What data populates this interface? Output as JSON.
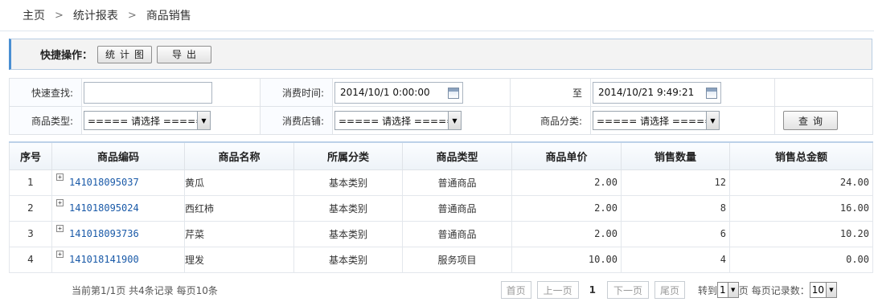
{
  "breadcrumb": {
    "items": [
      "主页",
      "统计报表",
      "商品销售"
    ],
    "separator": ">"
  },
  "quick_actions": {
    "label": "快捷操作：",
    "buttons": [
      "统计图",
      "导出"
    ]
  },
  "filters": {
    "quick_search_label": "快速查找:",
    "quick_search_value": "",
    "time_label": "消费时间:",
    "time_from": "2014/10/1 0:00:00",
    "to_label": "至",
    "time_to": "2014/10/21 9:49:21",
    "product_type_label": "商品类型:",
    "product_type_value": "===== 请选择 =====",
    "store_label": "消费店铺:",
    "store_value": "===== 请选择 =====",
    "category_label": "商品分类:",
    "category_value": "===== 请选择 =====",
    "query_button": "查询"
  },
  "table": {
    "headers": [
      "序号",
      "商品编码",
      "商品名称",
      "所属分类",
      "商品类型",
      "商品单价",
      "销售数量",
      "销售总金额"
    ],
    "rows": [
      {
        "no": "1",
        "code": "141018095037",
        "name": "黄瓜",
        "category": "基本类别",
        "type": "普通商品",
        "price": "2.00",
        "qty": "12",
        "total": "24.00"
      },
      {
        "no": "2",
        "code": "141018095024",
        "name": "西红柿",
        "category": "基本类别",
        "type": "普通商品",
        "price": "2.00",
        "qty": "8",
        "total": "16.00"
      },
      {
        "no": "3",
        "code": "141018093736",
        "name": "芹菜",
        "category": "基本类别",
        "type": "普通商品",
        "price": "2.00",
        "qty": "6",
        "total": "10.20"
      },
      {
        "no": "4",
        "code": "141018141900",
        "name": "理发",
        "category": "基本类别",
        "type": "服务项目",
        "price": "10.00",
        "qty": "4",
        "total": "0.00"
      }
    ],
    "expand_icon": "+",
    "total_color": "#dd0000"
  },
  "pager": {
    "summary": "当前第1/1页 共4条记录 每页10条",
    "first": "首页",
    "prev": "上一页",
    "current": "1",
    "next": "下一页",
    "last": "尾页",
    "goto_label": "转到",
    "goto_value": "1",
    "page_suffix": "页",
    "per_page_label": "每页记录数：",
    "per_page_value": "10"
  },
  "colors": {
    "accent": "#4a8fd2",
    "link": "#1a5aa8"
  }
}
